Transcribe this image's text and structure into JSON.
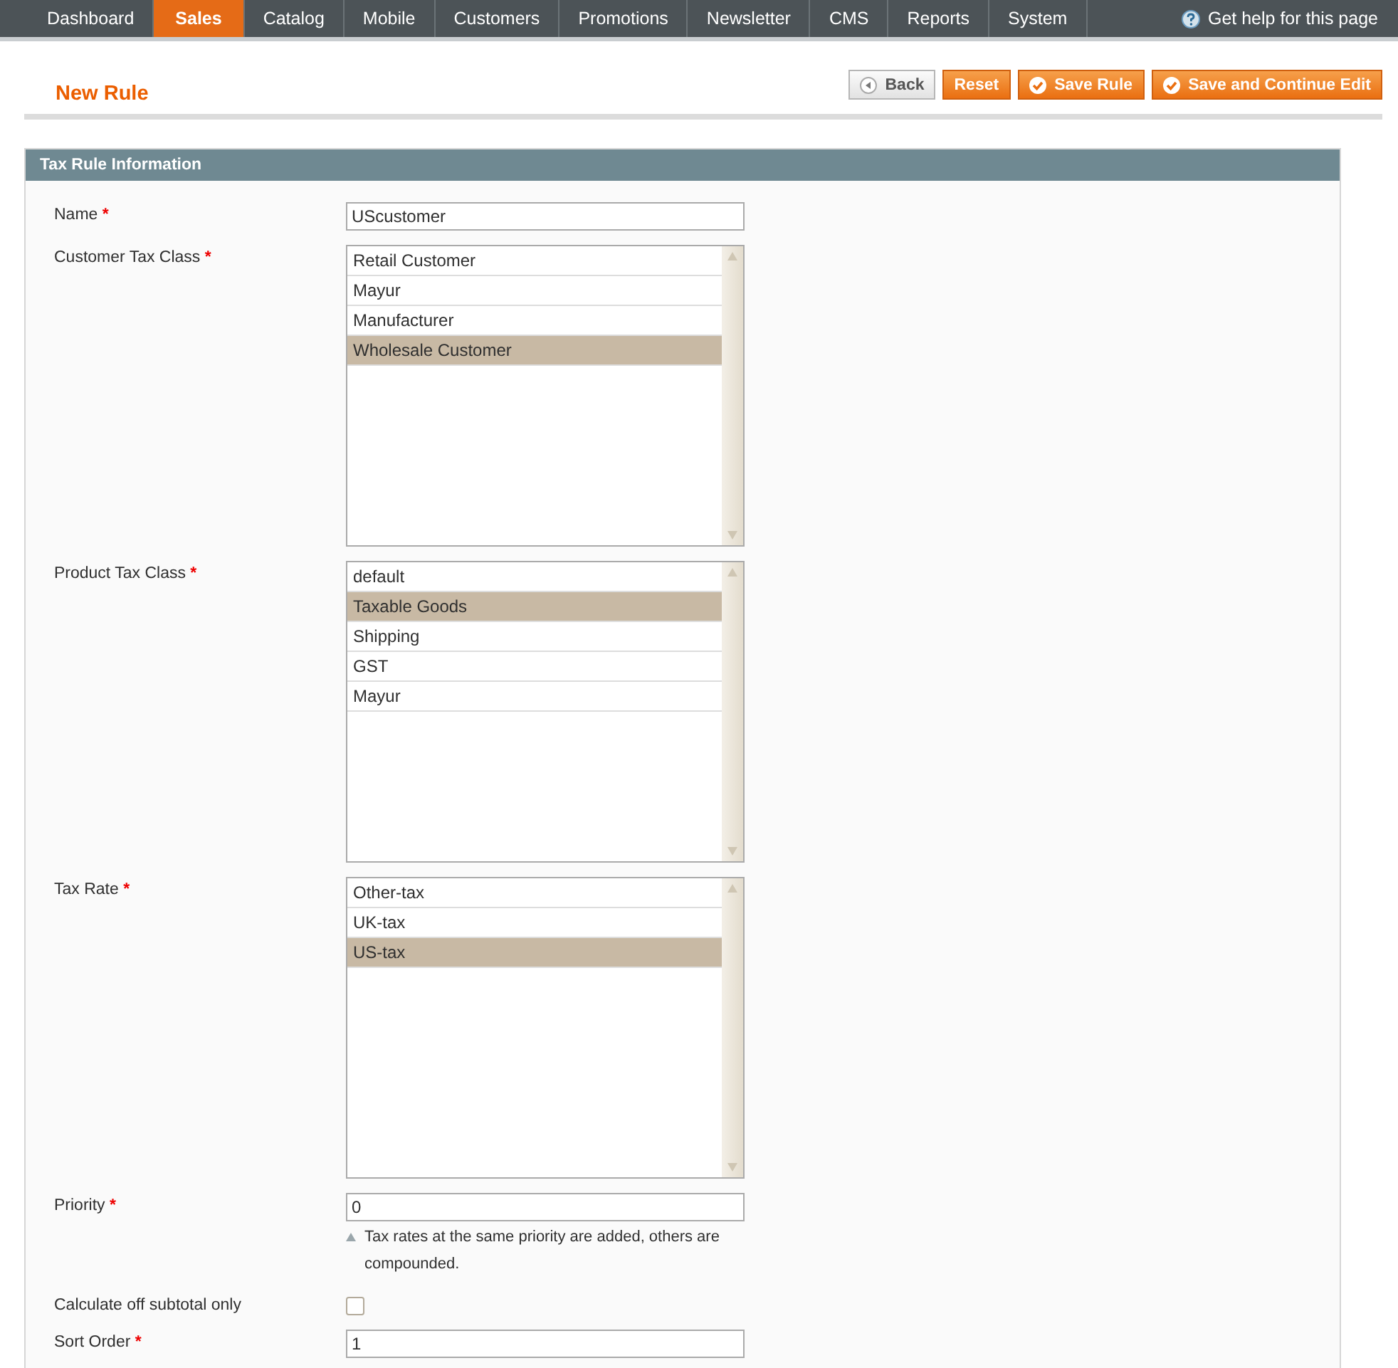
{
  "nav": {
    "items": [
      {
        "label": "Dashboard",
        "selected": false
      },
      {
        "label": "Sales",
        "selected": true
      },
      {
        "label": "Catalog",
        "selected": false
      },
      {
        "label": "Mobile",
        "selected": false
      },
      {
        "label": "Customers",
        "selected": false
      },
      {
        "label": "Promotions",
        "selected": false
      },
      {
        "label": "Newsletter",
        "selected": false
      },
      {
        "label": "CMS",
        "selected": false
      },
      {
        "label": "Reports",
        "selected": false
      },
      {
        "label": "System",
        "selected": false
      }
    ],
    "help": "Get help for this page"
  },
  "page": {
    "title": "New Rule",
    "buttons": [
      {
        "label": "Back",
        "kind": "back"
      },
      {
        "label": "Reset",
        "kind": "plain"
      },
      {
        "label": "Save Rule",
        "kind": "save"
      },
      {
        "label": "Save and Continue Edit",
        "kind": "save"
      }
    ]
  },
  "section": {
    "title": "Tax Rule Information",
    "fields": [
      {
        "kind": "text",
        "label": "Name",
        "required_mark": "*",
        "value": "UScustomer"
      },
      {
        "kind": "multiselect",
        "label": "Customer Tax Class",
        "required_mark": "*",
        "options": [
          {
            "label": "Retail Customer",
            "selected": false
          },
          {
            "label": "Mayur",
            "selected": false
          },
          {
            "label": "Manufacturer",
            "selected": false
          },
          {
            "label": "Wholesale Customer",
            "selected": true
          }
        ]
      },
      {
        "kind": "multiselect",
        "label": "Product Tax Class",
        "required_mark": "*",
        "options": [
          {
            "label": "default",
            "selected": false
          },
          {
            "label": "Taxable Goods",
            "selected": true
          },
          {
            "label": "Shipping",
            "selected": false
          },
          {
            "label": "GST",
            "selected": false
          },
          {
            "label": "Mayur",
            "selected": false
          }
        ]
      },
      {
        "kind": "multiselect",
        "label": "Tax Rate",
        "required_mark": "*",
        "options": [
          {
            "label": "Other-tax",
            "selected": false
          },
          {
            "label": "UK-tax",
            "selected": false
          },
          {
            "label": "US-tax",
            "selected": true
          }
        ]
      },
      {
        "kind": "text",
        "label": "Priority",
        "required_mark": "*",
        "value": "0",
        "hint": "Tax rates at the same priority are added, others are compounded."
      },
      {
        "kind": "checkbox",
        "label": "Calculate off subtotal only",
        "checked": false
      },
      {
        "kind": "text",
        "label": "Sort Order",
        "required_mark": "*",
        "value": "1"
      }
    ]
  }
}
